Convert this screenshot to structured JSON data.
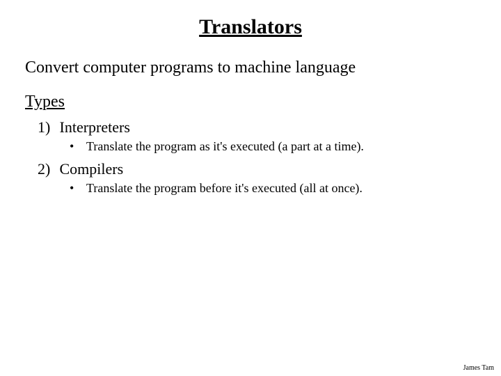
{
  "title": "Translators",
  "subtitle": "Convert computer programs to machine language",
  "section_heading": "Types",
  "items": [
    {
      "num": "1)",
      "label": "Interpreters",
      "detail": "Translate the program as it's executed (a part at a time)."
    },
    {
      "num": "2)",
      "label": "Compilers",
      "detail": "Translate the program before it's executed (all at once)."
    }
  ],
  "footer": "James Tam"
}
